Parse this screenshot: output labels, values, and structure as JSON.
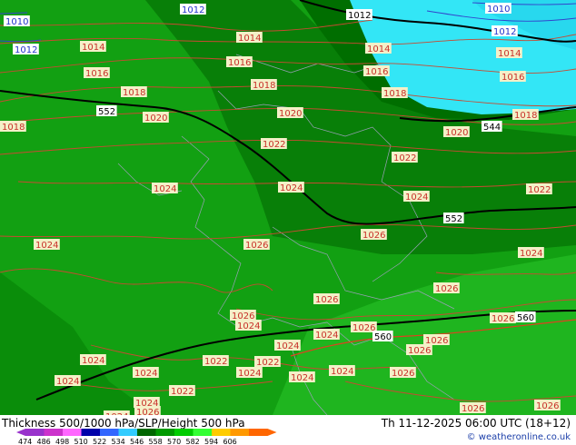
{
  "map": {
    "pressure_labels": [
      {
        "text": "1010",
        "c": "b"
      },
      {
        "text": "1012",
        "c": "b"
      },
      {
        "text": "1012",
        "c": "k"
      },
      {
        "text": "1010",
        "c": "b"
      },
      {
        "text": "1012",
        "c": "b"
      },
      {
        "text": "1012",
        "c": "b"
      },
      {
        "text": "1014",
        "c": "p"
      },
      {
        "text": "1014",
        "c": "p"
      },
      {
        "text": "1014",
        "c": "p"
      },
      {
        "text": "1014",
        "c": "p"
      },
      {
        "text": "1016",
        "c": "p"
      },
      {
        "text": "1016",
        "c": "p"
      },
      {
        "text": "1016",
        "c": "p"
      },
      {
        "text": "1016",
        "c": "p"
      },
      {
        "text": "1018",
        "c": "p"
      },
      {
        "text": "1018",
        "c": "p"
      },
      {
        "text": "1018",
        "c": "p"
      },
      {
        "text": "1018",
        "c": "p"
      },
      {
        "text": "1018",
        "c": "p"
      },
      {
        "text": "1020",
        "c": "p"
      },
      {
        "text": "1020",
        "c": "p"
      },
      {
        "text": "1020",
        "c": "p"
      },
      {
        "text": "1022",
        "c": "p"
      },
      {
        "text": "1022",
        "c": "p"
      },
      {
        "text": "1022",
        "c": "p"
      },
      {
        "text": "1024",
        "c": "p"
      },
      {
        "text": "1024",
        "c": "p"
      },
      {
        "text": "1024",
        "c": "p"
      },
      {
        "text": "1024",
        "c": "p"
      },
      {
        "text": "1024",
        "c": "p"
      },
      {
        "text": "1026",
        "c": "p"
      },
      {
        "text": "1026",
        "c": "p"
      },
      {
        "text": "1026",
        "c": "p"
      },
      {
        "text": "1026",
        "c": "p"
      },
      {
        "text": "1026",
        "c": "p"
      },
      {
        "text": "1024",
        "c": "p"
      },
      {
        "text": "1026",
        "c": "p"
      },
      {
        "text": "1024",
        "c": "p"
      },
      {
        "text": "1026",
        "c": "p"
      },
      {
        "text": "1026",
        "c": "p"
      },
      {
        "text": "1024",
        "c": "p"
      },
      {
        "text": "1022",
        "c": "p"
      },
      {
        "text": "1022",
        "c": "p"
      },
      {
        "text": "1024",
        "c": "p"
      },
      {
        "text": "1024",
        "c": "p"
      },
      {
        "text": "1024",
        "c": "p"
      },
      {
        "text": "1024",
        "c": "p"
      },
      {
        "text": "1024",
        "c": "p"
      },
      {
        "text": "1026",
        "c": "p"
      },
      {
        "text": "1022",
        "c": "p"
      },
      {
        "text": "1024",
        "c": "p"
      },
      {
        "text": "1024",
        "c": "p"
      },
      {
        "text": "1024",
        "c": "p"
      },
      {
        "text": "1026",
        "c": "p"
      },
      {
        "text": "1026",
        "c": "p"
      },
      {
        "text": "1026",
        "c": "p"
      },
      {
        "text": "1026",
        "c": "p"
      }
    ],
    "height_labels": [
      "552",
      "544",
      "552",
      "560",
      "560"
    ]
  },
  "footer": {
    "caption": "Thickness 500/1000 hPa/SLP/Height 500 hPa",
    "datetime": "Th 11-12-2025 06:00 UTC (18+12)",
    "credit": "© weatheronline.co.uk"
  },
  "legend": {
    "ticks": [
      "474",
      "486",
      "498",
      "510",
      "522",
      "534",
      "546",
      "558",
      "570",
      "582",
      "594",
      "606"
    ],
    "colors": [
      "#9933cc",
      "#cc33cc",
      "#ff66ff",
      "#0000aa",
      "#3366ff",
      "#33ccff",
      "#006600",
      "#009900",
      "#00cc00",
      "#33ff33",
      "#ffcc00",
      "#ff9900",
      "#ff6600"
    ]
  }
}
